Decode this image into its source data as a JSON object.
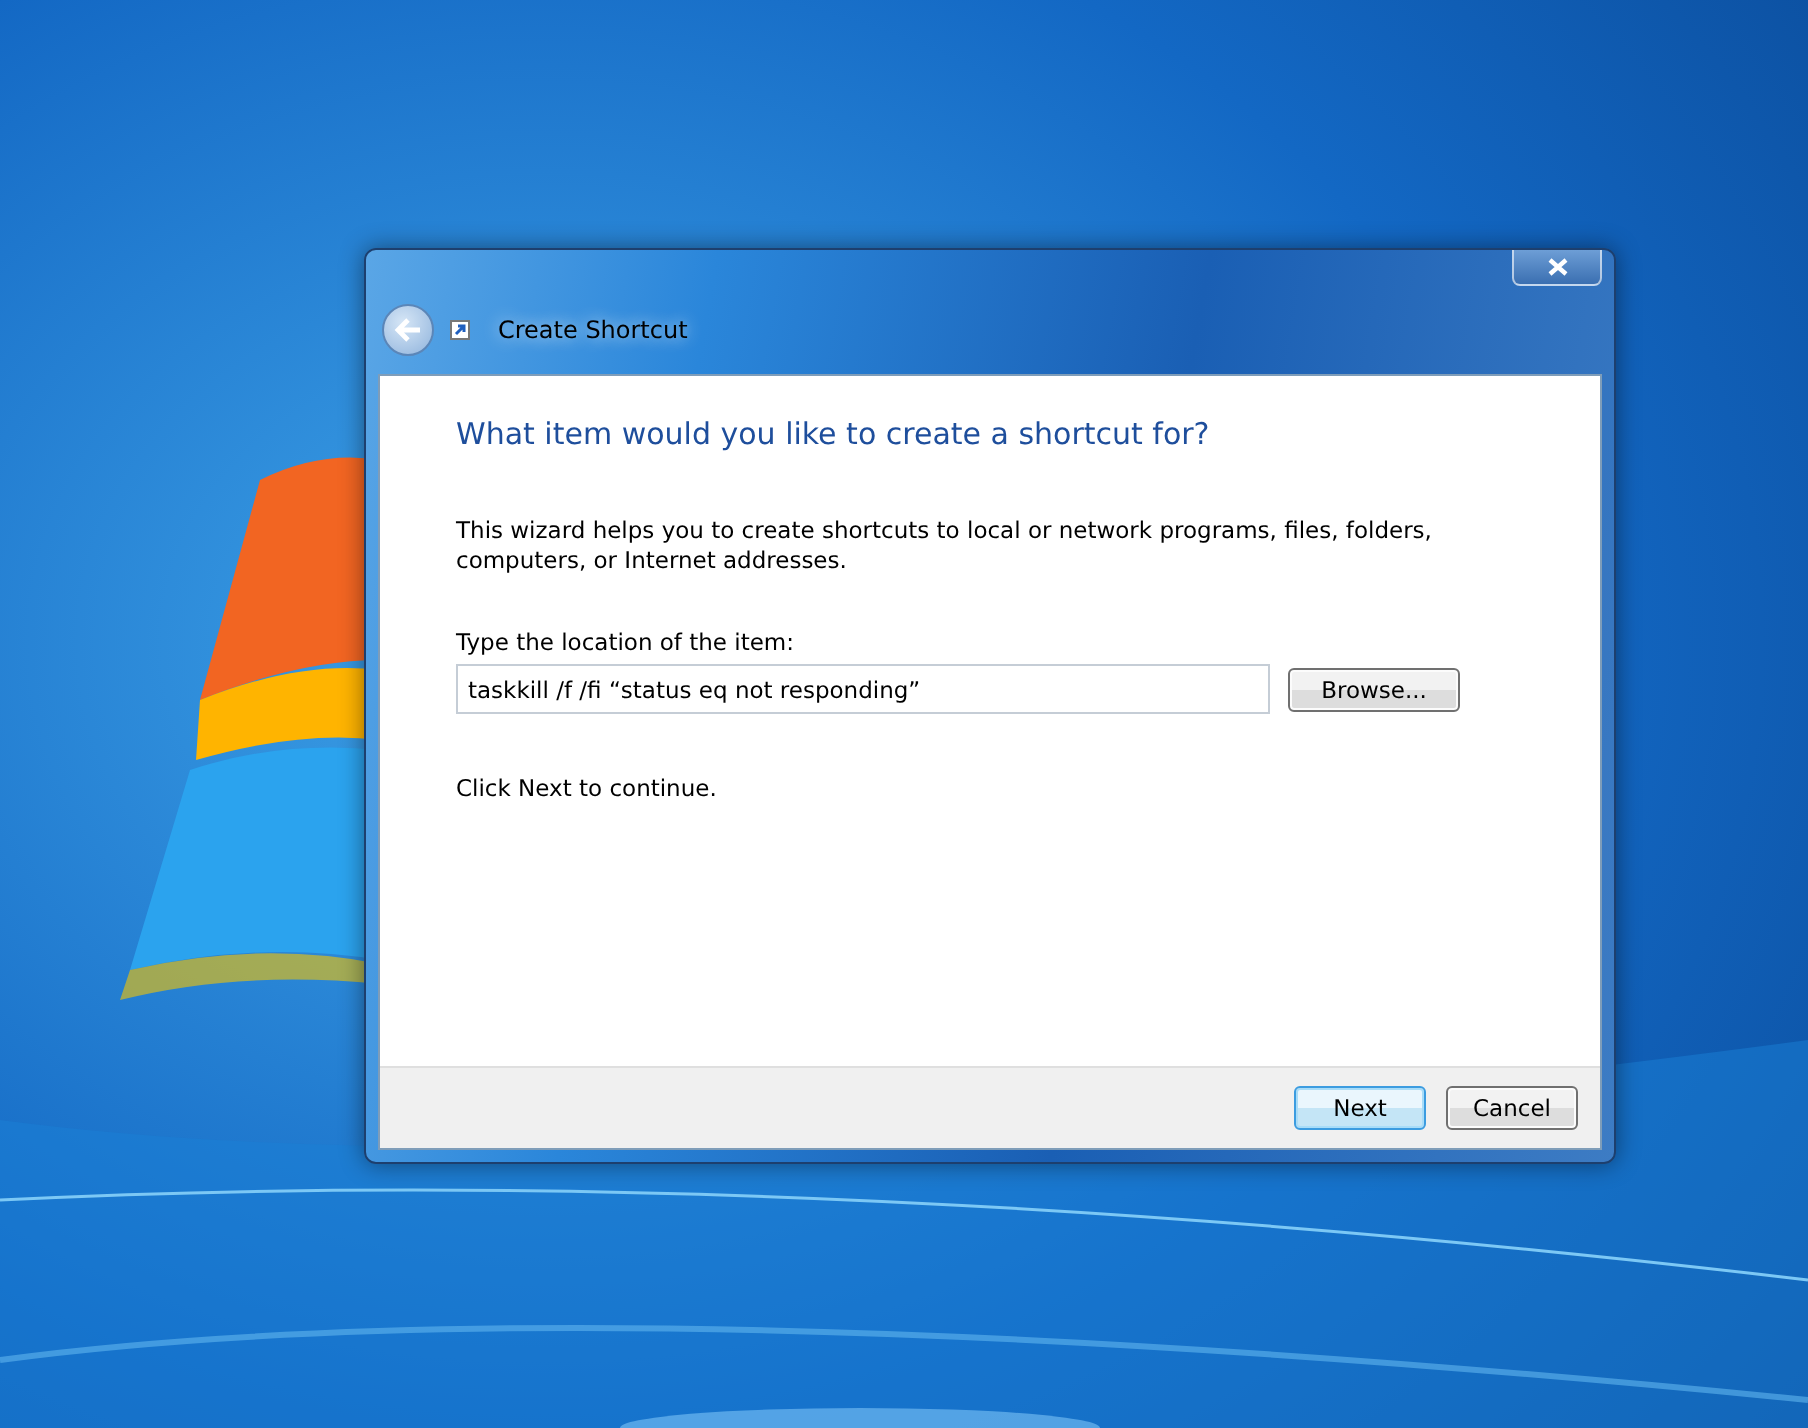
{
  "window": {
    "title": "Create Shortcut"
  },
  "wizard": {
    "heading": "What item would you like to create a shortcut for?",
    "description": "This wizard helps you to create shortcuts to local or network programs, files, folders, computers, or Internet addresses.",
    "location_label": "Type the location of the item:",
    "location_value": "taskkill /f /fi “status eq not responding”",
    "browse_button": "Browse...",
    "instruction": "Click Next to continue."
  },
  "buttons": [
    {
      "label": "Next",
      "default": true
    },
    {
      "label": "Cancel",
      "default": false
    }
  ]
}
